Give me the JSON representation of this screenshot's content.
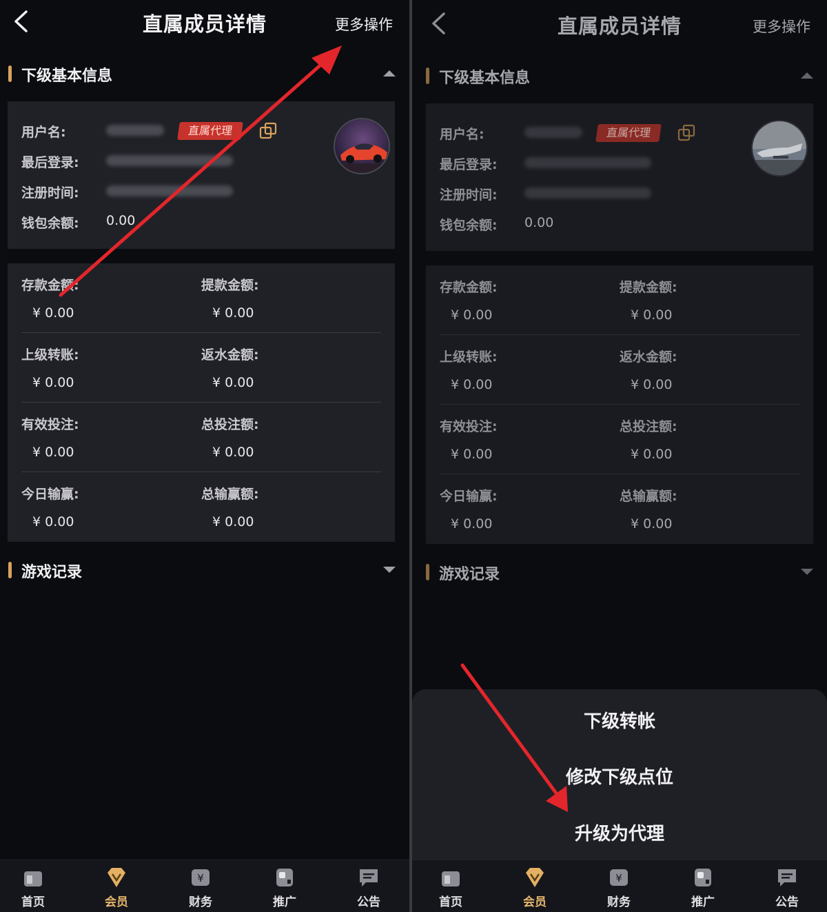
{
  "header": {
    "title": "直属成员详情",
    "more_label": "更多操作"
  },
  "basic_info": {
    "title": "下级基本信息",
    "username_label": "用户名:",
    "last_login_label": "最后登录:",
    "register_label": "注册时间:",
    "wallet_label": "钱包余额:",
    "wallet_value": "0.00",
    "tag": "直属代理"
  },
  "stats": [
    {
      "left_label": "存款金额:",
      "left_value": "¥ 0.00",
      "right_label": "提款金额:",
      "right_value": "¥ 0.00"
    },
    {
      "left_label": "上级转账:",
      "left_value": "¥ 0.00",
      "right_label": "返水金额:",
      "right_value": "¥ 0.00"
    },
    {
      "left_label": "有效投注:",
      "left_value": "¥ 0.00",
      "right_label": "总投注额:",
      "right_value": "¥ 0.00"
    },
    {
      "left_label": "今日输赢:",
      "left_value": "¥ 0.00",
      "right_label": "总输赢额:",
      "right_value": "¥ 0.00"
    }
  ],
  "game_records": {
    "title": "游戏记录"
  },
  "action_sheet": {
    "items": [
      "下级转帐",
      "修改下级点位",
      "升级为代理"
    ]
  },
  "tabbar": {
    "items": [
      {
        "label": "首页",
        "icon": "home-icon"
      },
      {
        "label": "会员",
        "icon": "member-diamond-icon"
      },
      {
        "label": "财务",
        "icon": "finance-yen-icon"
      },
      {
        "label": "推广",
        "icon": "promote-icon"
      },
      {
        "label": "公告",
        "icon": "announcement-icon"
      }
    ],
    "active_index": 1
  },
  "colors": {
    "background": "#0b0c10",
    "card": "#202127",
    "accent_gold": "#d9a35c",
    "tag_red": "#c7332c",
    "annotation_arrow": "#e3262b"
  }
}
